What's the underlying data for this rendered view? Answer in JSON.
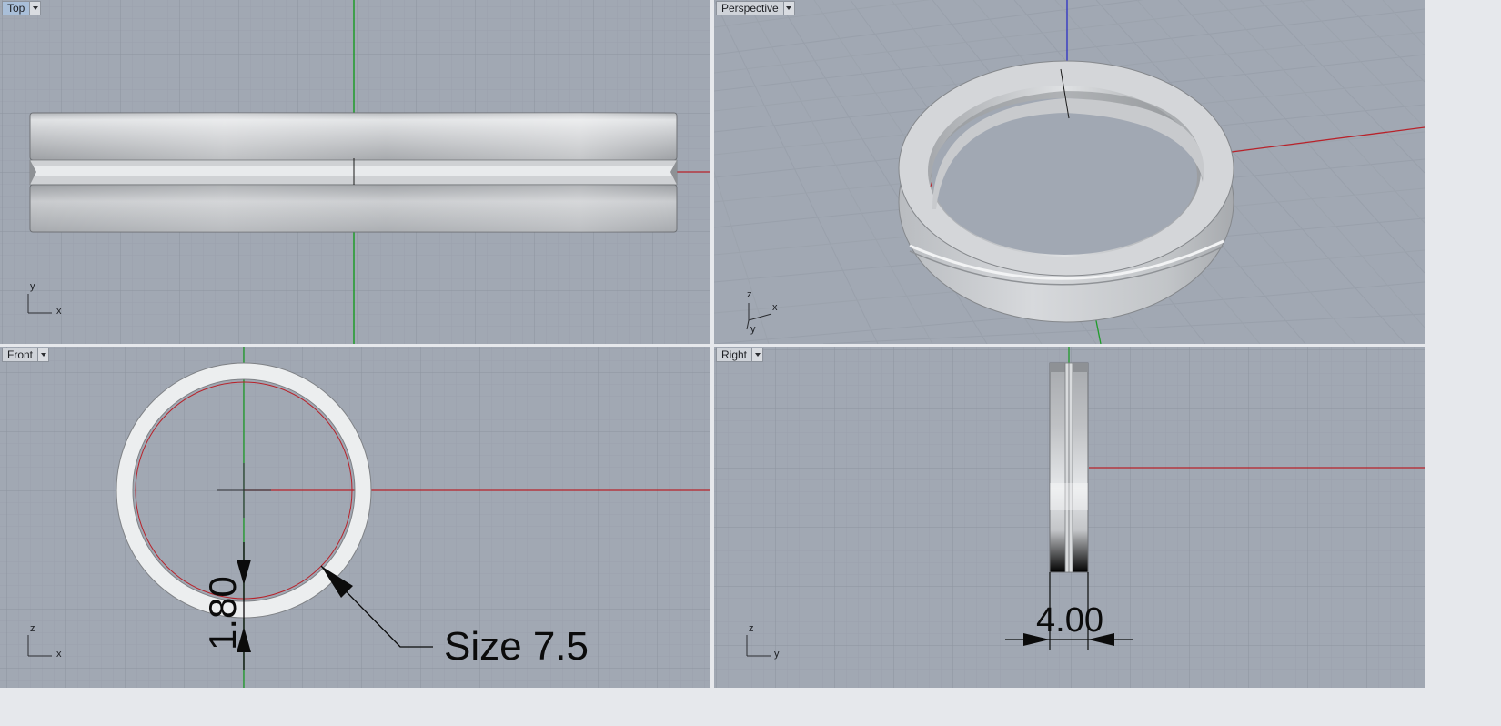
{
  "viewports": {
    "top": {
      "label": "Top",
      "axis_v": "y",
      "axis_h": "x"
    },
    "perspective": {
      "label": "Perspective",
      "axis_v": "z",
      "axis_h": "x",
      "axis_d": "y"
    },
    "front": {
      "label": "Front",
      "axis_v": "z",
      "axis_h": "x"
    },
    "right": {
      "label": "Right",
      "axis_v": "z",
      "axis_h": "y"
    }
  },
  "dimensions": {
    "thickness": "1.80",
    "ring_size": "Size 7.5",
    "width": "4.00"
  },
  "colors": {
    "viewport_bg": "#a1a8b3",
    "grid_minor": "#9aa1ac",
    "grid_major": "#8c939e",
    "x_axis": "#b8222a",
    "y_axis": "#1f9c2a",
    "z_axis": "#2c2fc4",
    "active_tab": "#a9bfd9"
  },
  "icons": {
    "viewport_menu": "chevron-down-icon",
    "dimension_arrow": "arrowhead-icon"
  }
}
